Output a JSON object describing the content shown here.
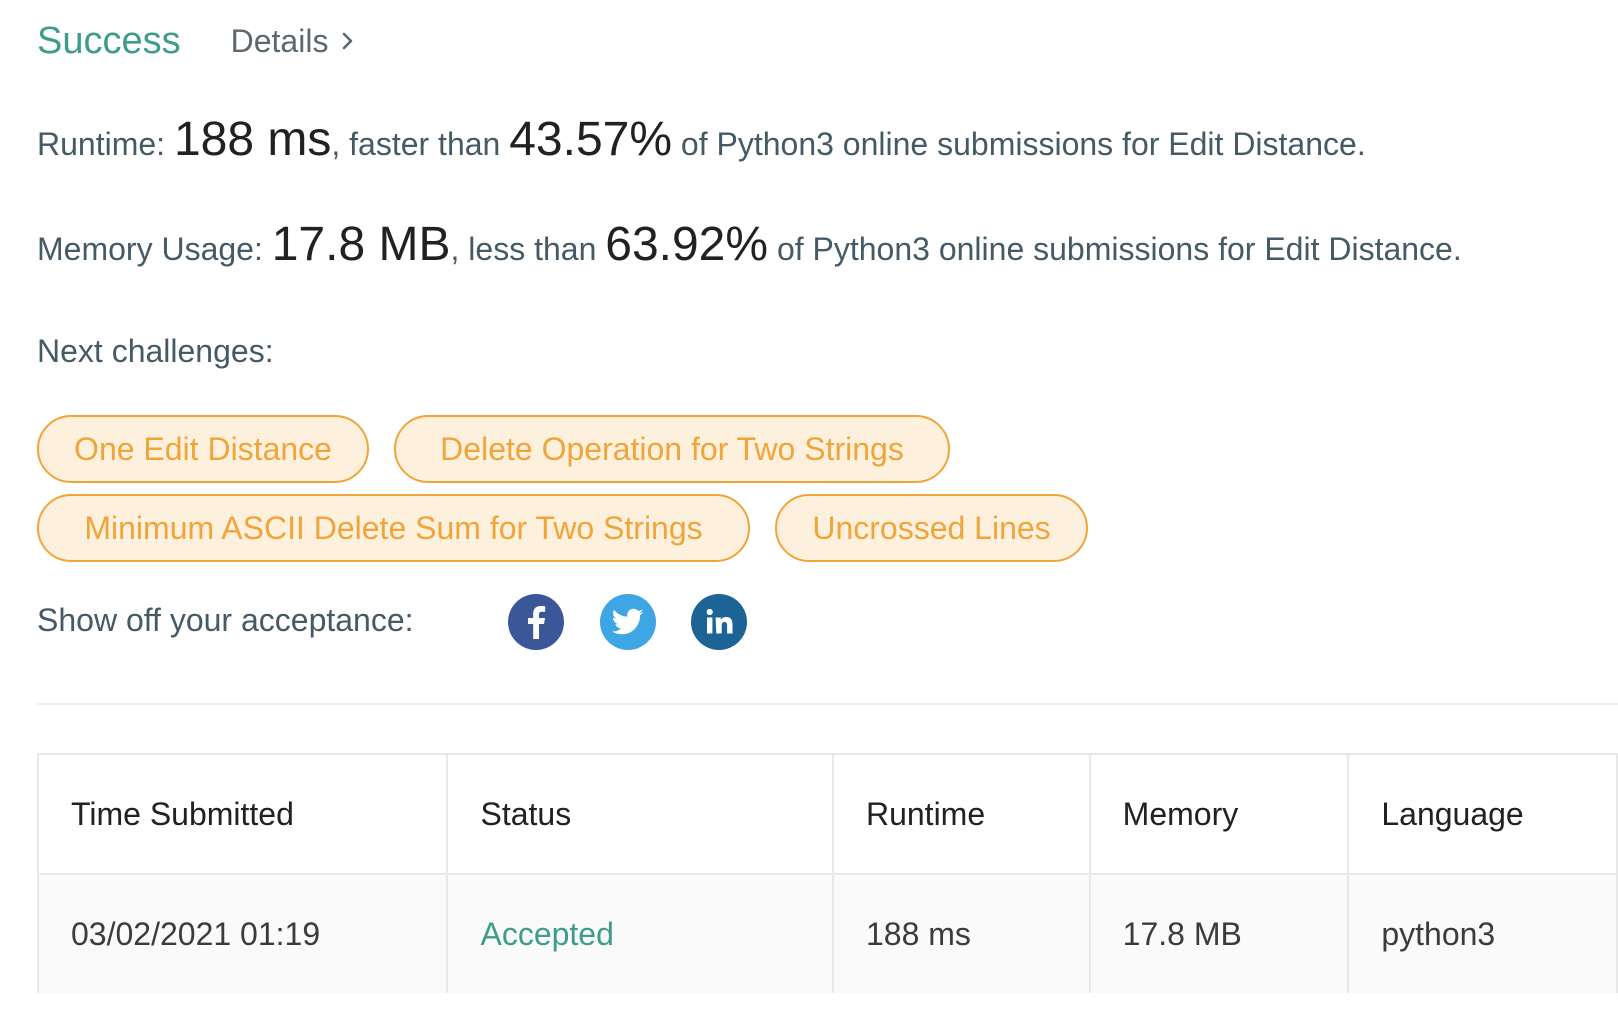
{
  "header": {
    "status": "Success",
    "details_label": "Details"
  },
  "runtime": {
    "label": "Runtime:",
    "value": "188 ms",
    "mid_text": ", faster than",
    "percent": "43.57%",
    "tail_text": "of Python3 online submissions for Edit Distance."
  },
  "memory": {
    "label": "Memory Usage:",
    "value": "17.8 MB",
    "mid_text": ", less than",
    "percent": "63.92%",
    "tail_text": "of Python3 online submissions for Edit Distance."
  },
  "next_challenges": {
    "label": "Next challenges:",
    "items": [
      "One Edit Distance",
      "Delete Operation for Two Strings",
      "Minimum ASCII Delete Sum for Two Strings",
      "Uncrossed Lines"
    ]
  },
  "share": {
    "label": "Show off your acceptance:",
    "icons": [
      "facebook-icon",
      "twitter-icon",
      "linkedin-icon"
    ]
  },
  "table": {
    "headers": [
      "Time Submitted",
      "Status",
      "Runtime",
      "Memory",
      "Language"
    ],
    "rows": [
      {
        "time": "03/02/2021 01:19",
        "status": "Accepted",
        "runtime": "188 ms",
        "memory": "17.8 MB",
        "language": "python3"
      }
    ]
  },
  "colors": {
    "success": "#3e9c8a",
    "chip_border": "#f0a53a",
    "chip_bg": "#fdf0dc",
    "facebook": "#3b5798",
    "twitter": "#3fa6e6",
    "linkedin": "#1d6496"
  }
}
